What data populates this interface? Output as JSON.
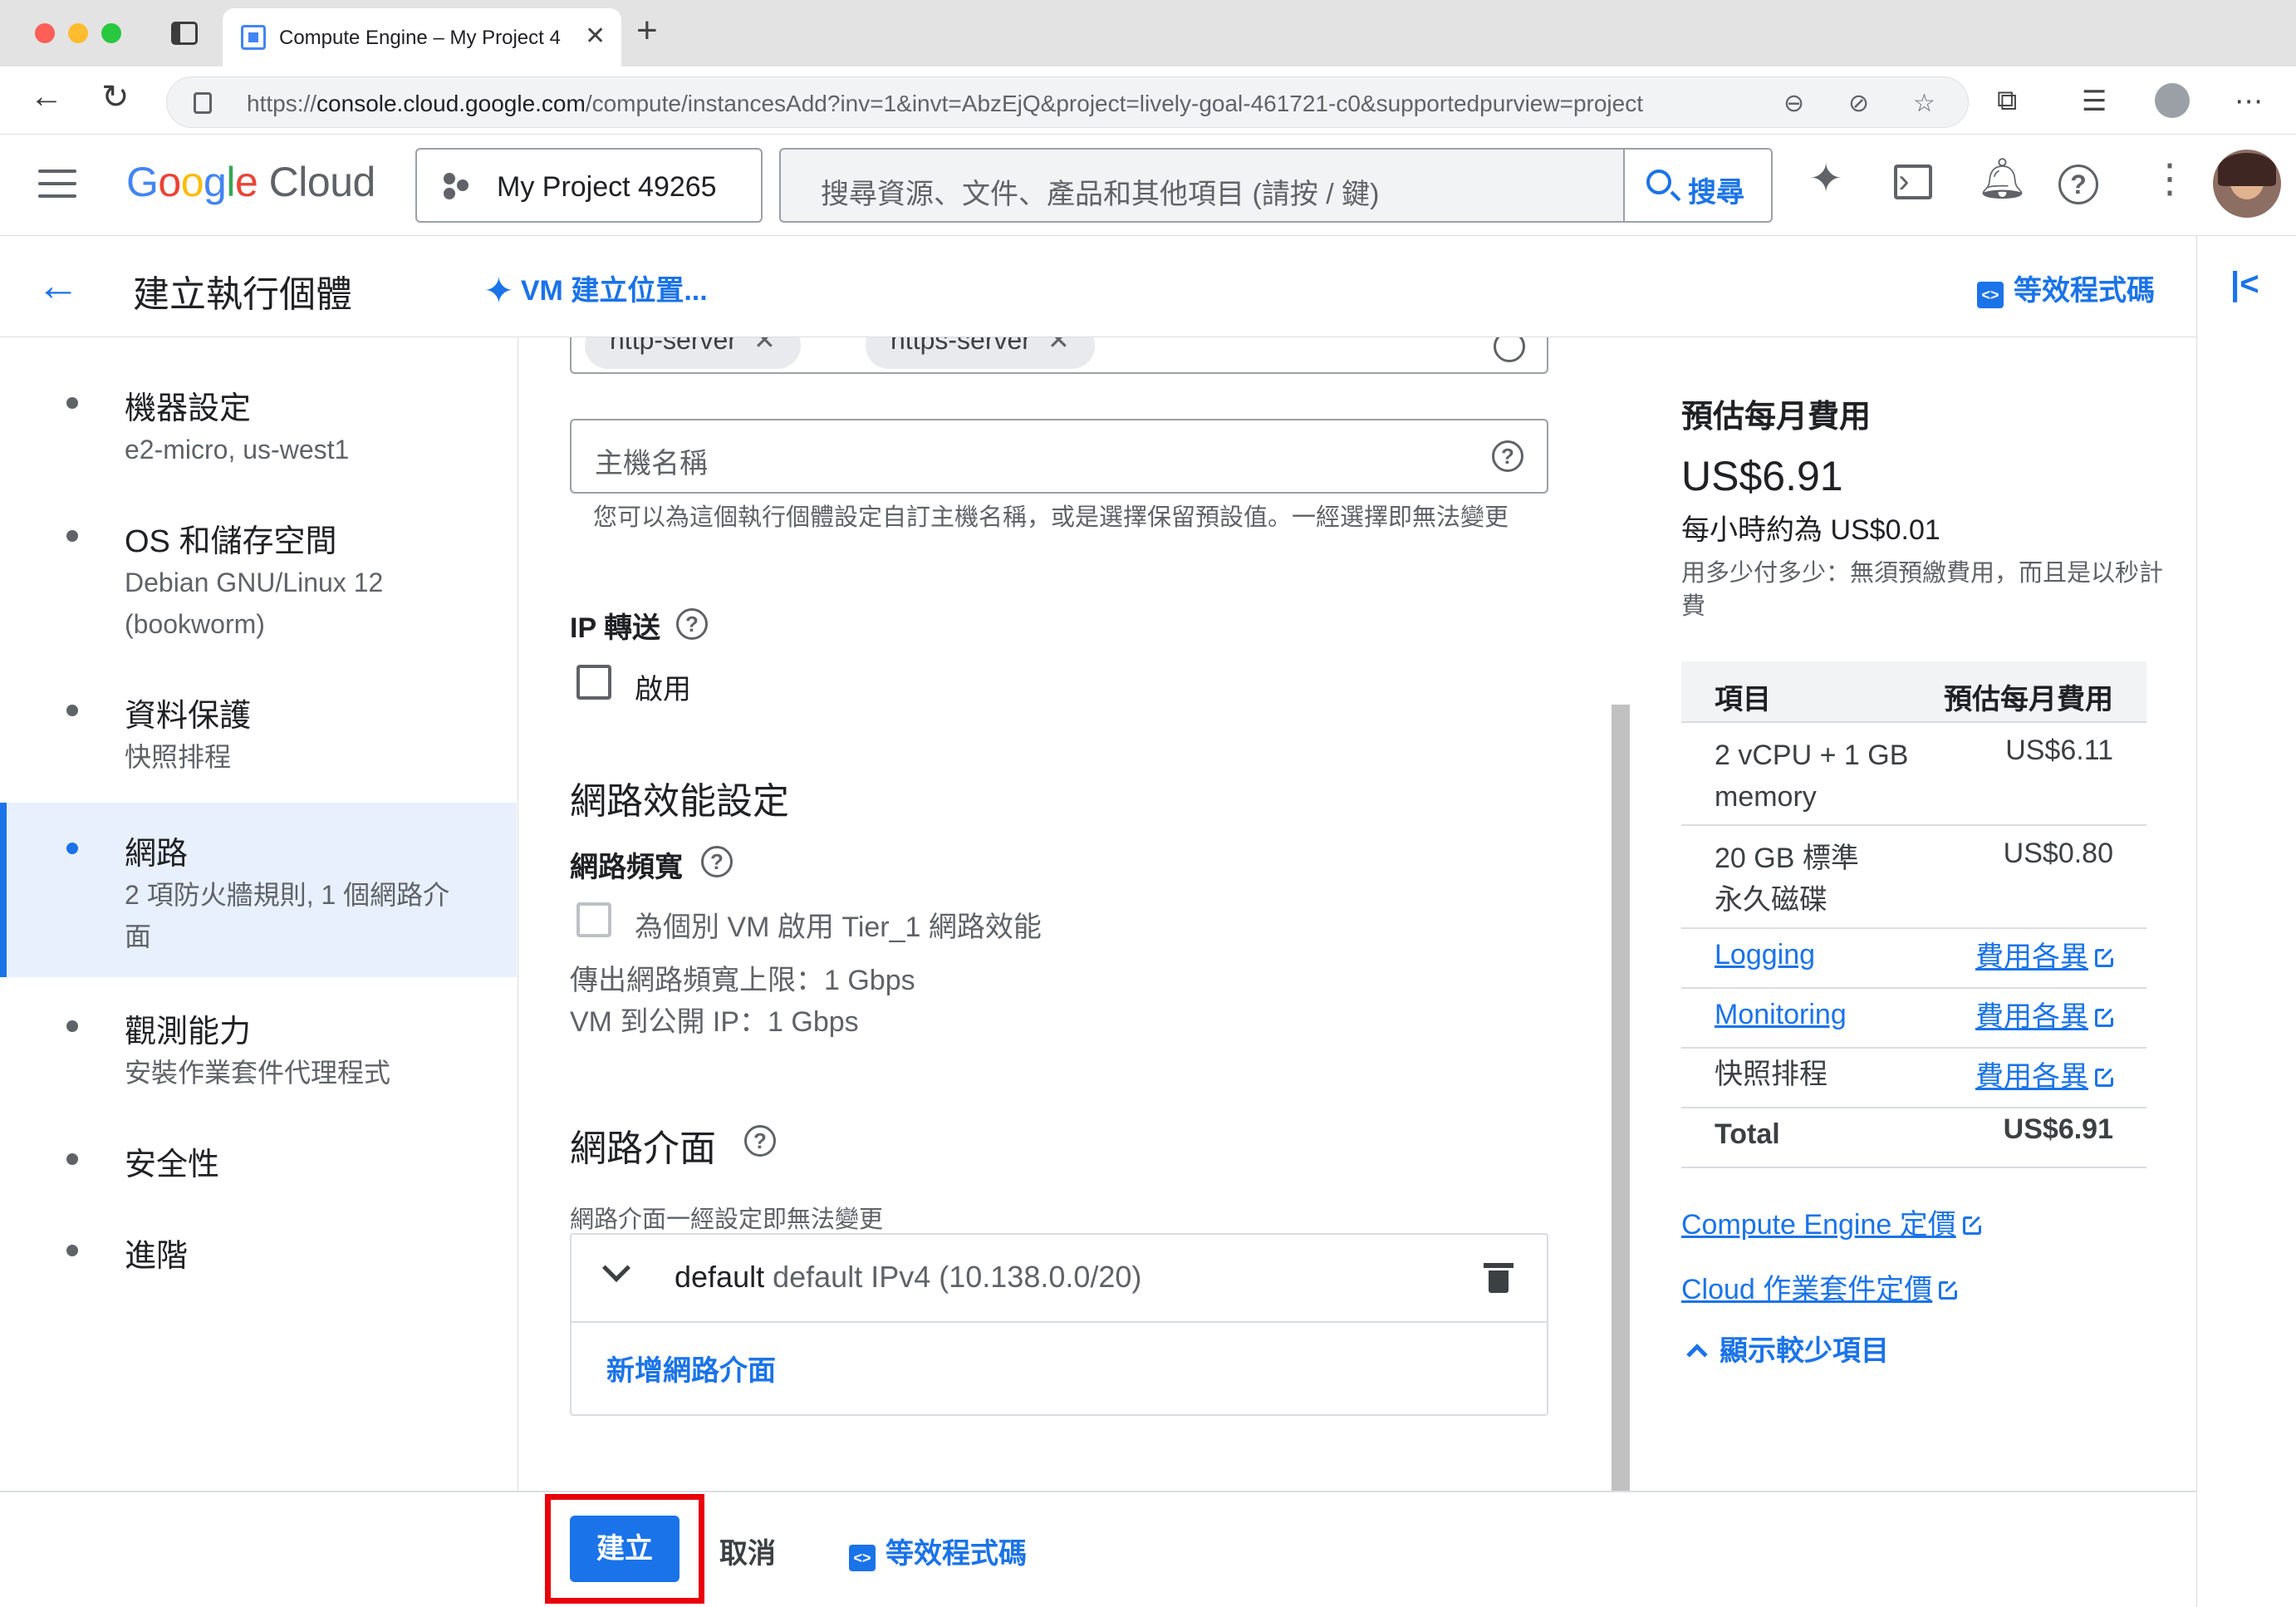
{
  "browser": {
    "tab_title": "Compute Engine – My Project 4",
    "url_prefix": "https://",
    "url_domain": "console.cloud.google.com",
    "url_path": "/compute/instancesAdd?inv=1&invt=AbzEjQ&project=lively-goal-461721-c0&supportedpurview=project"
  },
  "header": {
    "logo_google": [
      "G",
      "o",
      "o",
      "g",
      "l",
      "e"
    ],
    "logo_cloud": "Cloud",
    "project_label": "My Project 49265",
    "search_placeholder": "搜尋資源、文件、產品和其他項目 (請按 / 鍵)",
    "search_button": "搜尋"
  },
  "titlebar": {
    "title": "建立執行個體",
    "vm_location_link": "VM 建立位置...",
    "equivalent_code": "等效程式碼"
  },
  "steps": [
    {
      "title": "機器設定",
      "subtitle": "e2-micro, us-west1",
      "active": false
    },
    {
      "title": "OS 和儲存空間",
      "subtitle": "Debian GNU/Linux 12 (bookworm)",
      "active": false
    },
    {
      "title": "資料保護",
      "subtitle": "快照排程",
      "active": false
    },
    {
      "title": "網路",
      "subtitle": "2 項防火牆規則, 1 個網路介面",
      "active": true
    },
    {
      "title": "觀測能力",
      "subtitle": "安裝作業套件代理程式",
      "active": false
    },
    {
      "title": "安全性",
      "subtitle": "",
      "active": false
    },
    {
      "title": "進階",
      "subtitle": "",
      "active": false
    }
  ],
  "form": {
    "tags": [
      "http-server",
      "https-server"
    ],
    "hostname_placeholder": "主機名稱",
    "hostname_help": "您可以為這個執行個體設定自訂主機名稱，或是選擇保留預設值。一經選擇即無法變更",
    "ip_forwarding_label": "IP 轉送",
    "ip_forwarding_checkbox": "啟用",
    "ip_forwarding_checked": false,
    "network_perf_heading": "網路效能設定",
    "bandwidth_label": "網路頻寬",
    "tier1_checkbox": "為個別 VM 啟用 Tier_1 網路效能",
    "tier1_checked": false,
    "egress_limit": "傳出網路頻寬上限：1 Gbps",
    "public_ip_limit": "VM 到公開 IP：1 Gbps",
    "nic_heading": "網路介面",
    "nic_note": "網路介面一經設定即無法變更",
    "nic_name": "default",
    "nic_detail": "default IPv4 (10.138.0.0/20)",
    "add_nic": "新增網路介面"
  },
  "cost": {
    "title": "預估每月費用",
    "amount": "US$6.91",
    "hourly": "每小時約為 US$0.01",
    "note": "用多少付多少：無須預繳費用，而且是以秒計費",
    "table_headers": [
      "項目",
      "預估每月費用"
    ],
    "rows": [
      {
        "item": "2 vCPU + 1 GB memory",
        "value": "US$6.11",
        "item_link": false,
        "value_link": false
      },
      {
        "item": "20 GB 標準永久磁碟",
        "value": "US$0.80",
        "item_link": false,
        "value_link": false
      },
      {
        "item": "Logging",
        "value": "費用各異",
        "item_link": true,
        "value_link": true
      },
      {
        "item": "Monitoring",
        "value": "費用各異",
        "item_link": true,
        "value_link": true
      },
      {
        "item": "快照排程",
        "value": "費用各異",
        "item_link": false,
        "value_link": true
      }
    ],
    "total_label": "Total",
    "total_value": "US$6.91",
    "pricing_link_1": "Compute Engine 定價",
    "pricing_link_2": "Cloud 作業套件定價",
    "show_less": "顯示較少項目"
  },
  "footer": {
    "create": "建立",
    "cancel": "取消",
    "equivalent_code": "等效程式碼"
  },
  "colors": {
    "accent": "#1a73e8",
    "highlight_box": "#e8000b"
  }
}
